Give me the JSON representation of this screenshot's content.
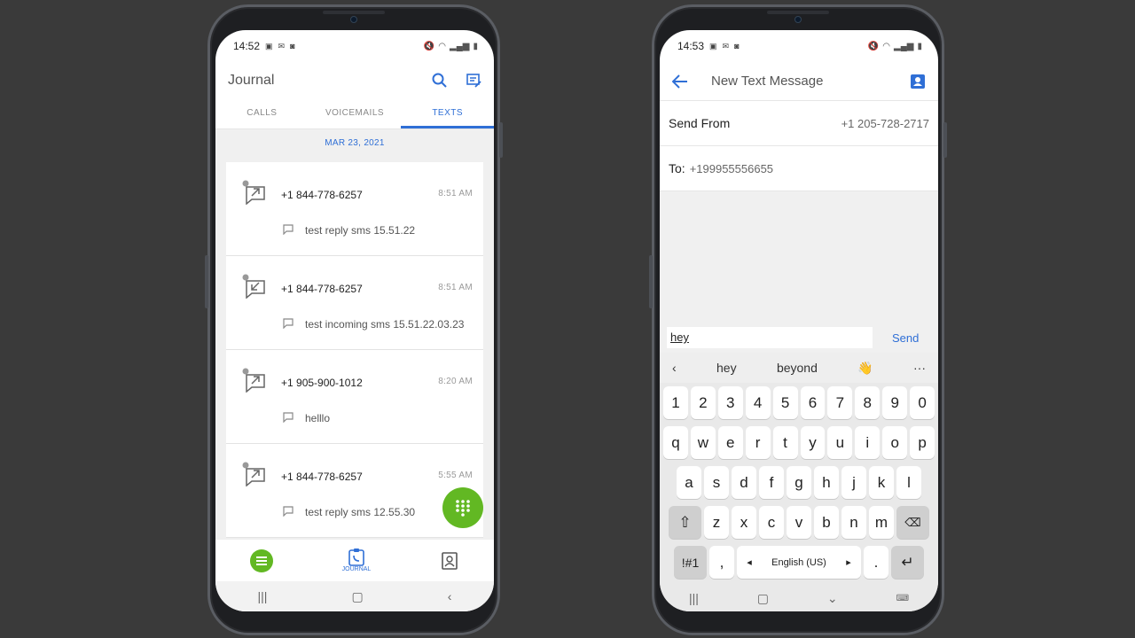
{
  "left": {
    "status_time": "14:52",
    "title": "Journal",
    "tabs": [
      "CALLS",
      "VOICEMAILS",
      "TEXTS"
    ],
    "date_header": "MAR 23, 2021",
    "items": [
      {
        "number": "+1 844-778-6257",
        "time": "8:51 AM",
        "message": "test reply sms 15.51.22",
        "direction": "outgoing"
      },
      {
        "number": "+1 844-778-6257",
        "time": "8:51 AM",
        "message": "test incoming sms 15.51.22.03.23",
        "direction": "incoming"
      },
      {
        "number": "+1 905-900-1012",
        "time": "8:20 AM",
        "message": "helllo",
        "direction": "outgoing"
      },
      {
        "number": "+1 844-778-6257",
        "time": "5:55 AM",
        "message": "test reply sms 12.55.30",
        "direction": "outgoing"
      }
    ],
    "nav_journal": "JOURNAL"
  },
  "right": {
    "status_time": "14:53",
    "title": "New Text Message",
    "send_from_label": "Send From",
    "send_from_value": "+1 205-728-2717",
    "to_label": "To:",
    "to_value": "+199955556655",
    "input_value": "hey",
    "send_label": "Send",
    "suggestions": [
      "hey",
      "beyond",
      "👋"
    ],
    "keys_row1": [
      "1",
      "2",
      "3",
      "4",
      "5",
      "6",
      "7",
      "8",
      "9",
      "0"
    ],
    "keys_row2": [
      "q",
      "w",
      "e",
      "r",
      "t",
      "y",
      "u",
      "i",
      "o",
      "p"
    ],
    "keys_row3": [
      "a",
      "s",
      "d",
      "f",
      "g",
      "h",
      "j",
      "k",
      "l"
    ],
    "keys_row4": [
      "z",
      "x",
      "c",
      "v",
      "b",
      "n",
      "m"
    ],
    "sym_label": "!#1",
    "comma": ",",
    "space_label": "English (US)",
    "period": "."
  },
  "colors": {
    "accent": "#2f6fd6",
    "fab": "#62b823"
  }
}
